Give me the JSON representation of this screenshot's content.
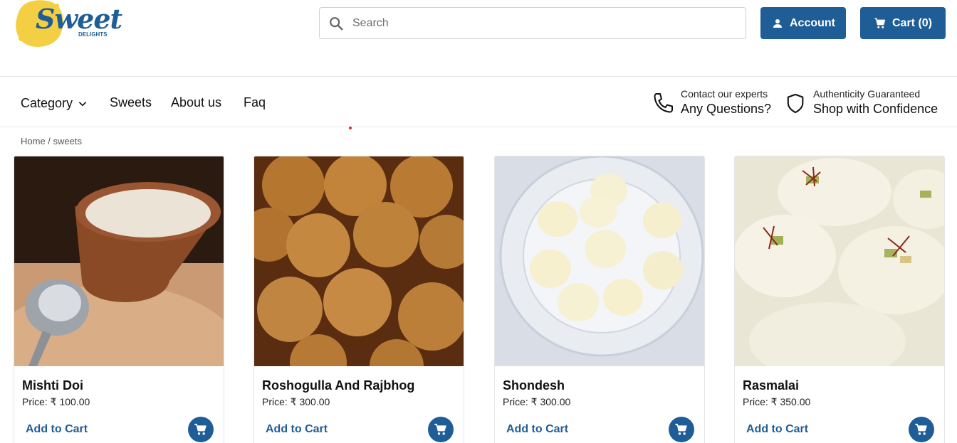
{
  "brand": {
    "logo_text": "Sweet",
    "logo_sub": "DELIGHTS"
  },
  "search": {
    "placeholder": "Search"
  },
  "header": {
    "account_label": "Account",
    "cart_label": "Cart (0)"
  },
  "nav": {
    "category_label": "Category",
    "sweets_label": "Sweets",
    "about_label": "About us",
    "faq_label": "Faq"
  },
  "info": {
    "contact_small": "Contact our experts",
    "contact_big": "Any Questions?",
    "auth_small": "Authenticity Guaranteed",
    "auth_big": "Shop with Confidence"
  },
  "breadcrumb": "Home / sweets",
  "products": [
    {
      "name": "Mishti Doi",
      "price": "Price: ₹ 100.00",
      "add_label": "Add to Cart"
    },
    {
      "name": "Roshogulla And Rajbhog",
      "price": "Price: ₹ 300.00",
      "add_label": "Add to Cart"
    },
    {
      "name": "Shondesh",
      "price": "Price: ₹ 300.00",
      "add_label": "Add to Cart"
    },
    {
      "name": "Rasmalai",
      "price": "Price: ₹ 350.00",
      "add_label": "Add to Cart"
    }
  ],
  "icons": {
    "search": "search-icon",
    "account": "person-icon",
    "cart": "cart-icon",
    "chevron": "chevron-down-icon",
    "phone": "phone-icon",
    "shield": "shield-icon"
  },
  "colors": {
    "primary": "#1f5d97",
    "logo_yellow": "#f5cf43"
  }
}
